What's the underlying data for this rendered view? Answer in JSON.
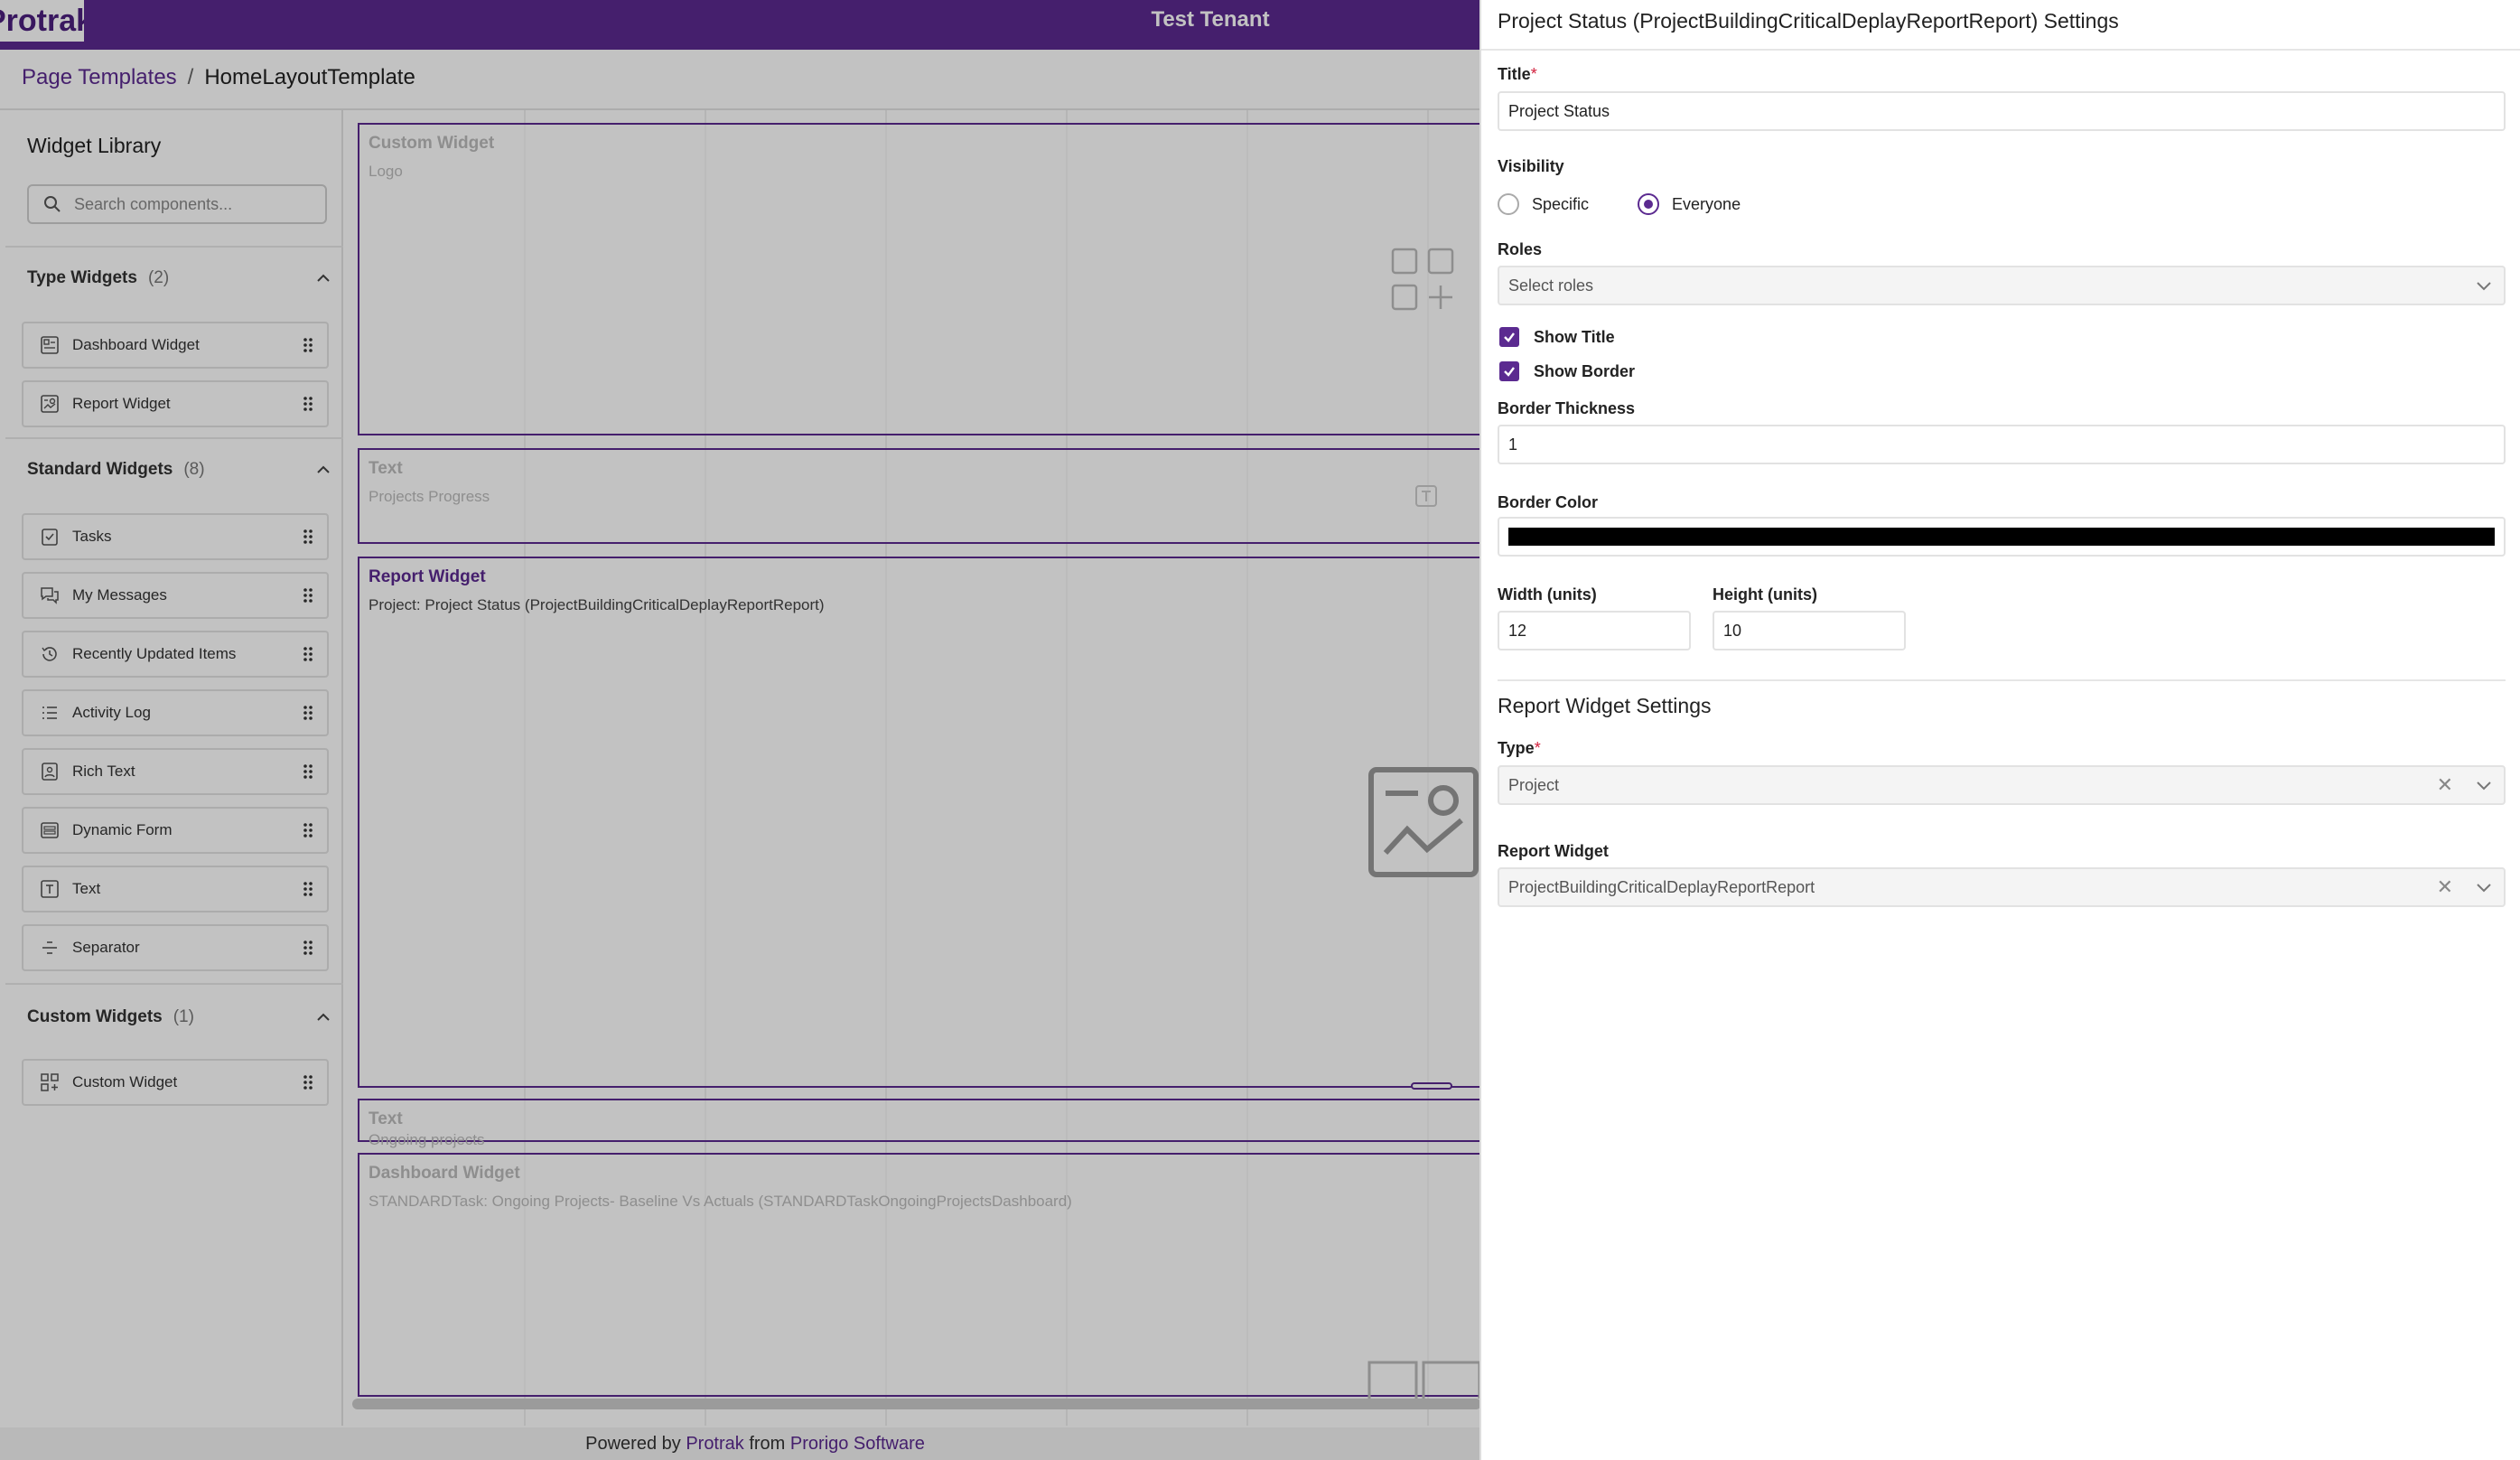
{
  "app": {
    "logo_text": "Protrak",
    "tenant": "Test Tenant"
  },
  "breadcrumb": {
    "parent": "Page Templates",
    "separator": "/",
    "current": "HomeLayoutTemplate"
  },
  "library": {
    "title": "Widget Library",
    "search_placeholder": "Search components...",
    "groups": [
      {
        "name": "Type Widgets",
        "count": "(2)",
        "items": [
          "Dashboard Widget",
          "Report Widget"
        ]
      },
      {
        "name": "Standard Widgets",
        "count": "(8)",
        "items": [
          "Tasks",
          "My Messages",
          "Recently Updated Items",
          "Activity Log",
          "Rich Text",
          "Dynamic Form",
          "Text",
          "Separator"
        ]
      },
      {
        "name": "Custom Widgets",
        "count": "(1)",
        "items": [
          "Custom Widget"
        ]
      }
    ]
  },
  "canvas": {
    "widgets": [
      {
        "title": "Custom Widget",
        "sub": "Logo"
      },
      {
        "title": "Text",
        "sub": "Projects Progress"
      },
      {
        "title": "Report Widget",
        "sub": "Project: Project Status (ProjectBuildingCriticalDeplayReportReport)"
      },
      {
        "title": "Text",
        "sub": "Ongoing projects"
      },
      {
        "title": "Dashboard Widget",
        "sub": "STANDARDTask: Ongoing Projects- Baseline Vs Actuals (STANDARDTaskOngoingProjectsDashboard)"
      }
    ]
  },
  "footer": {
    "prefix": "Powered by",
    "brand": "Protrak",
    "mid": "from",
    "company": "Prorigo Software"
  },
  "drawer": {
    "title": "Project Status (ProjectBuildingCriticalDeplayReportReport) Settings",
    "title_label": "Title",
    "required_mark": "*",
    "title_value": "Project Status",
    "visibility_label": "Visibility",
    "visibility_options": [
      "Specific",
      "Everyone"
    ],
    "visibility_selected": "Everyone",
    "roles_label": "Roles",
    "roles_placeholder": "Select roles",
    "show_title_label": "Show Title",
    "show_border_label": "Show Border",
    "border_thickness_label": "Border Thickness",
    "border_thickness_value": "1",
    "border_color_label": "Border Color",
    "border_color": "#000000",
    "width_label": "Width (units)",
    "width_value": "12",
    "height_label": "Height (units)",
    "height_value": "10",
    "section_title": "Report Widget Settings",
    "type_label": "Type",
    "type_value": "Project",
    "report_widget_label": "Report Widget",
    "report_widget_value": "ProjectBuildingCriticalDeplayReportReport"
  },
  "colors": {
    "brand": "#5b2a90",
    "required": "#d21f3c"
  }
}
